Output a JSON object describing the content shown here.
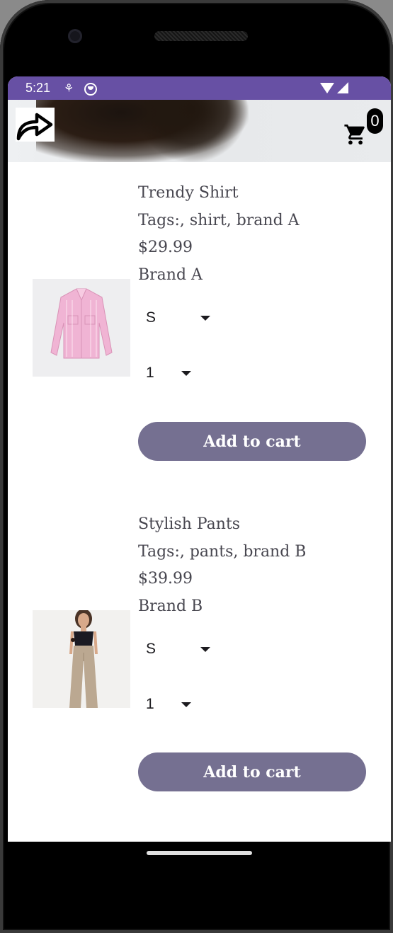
{
  "status_bar": {
    "time": "5:21"
  },
  "header": {
    "cart_count": "0"
  },
  "products": [
    {
      "name": "Trendy Shirt",
      "tags": "Tags:, shirt, brand A",
      "price": "$29.99",
      "brand": "Brand A",
      "size": "S",
      "quantity": "1",
      "add_label": "Add to cart"
    },
    {
      "name": "Stylish Pants",
      "tags": "Tags:, pants, brand B",
      "price": "$39.99",
      "brand": "Brand B",
      "size": "S",
      "quantity": "1",
      "add_label": "Add to cart"
    }
  ],
  "colors": {
    "status_bar": "#6750a4",
    "button": "#757091",
    "text": "#47464f"
  },
  "icons": {
    "back": "share-arrow-icon",
    "cart": "shopping-cart-icon"
  }
}
